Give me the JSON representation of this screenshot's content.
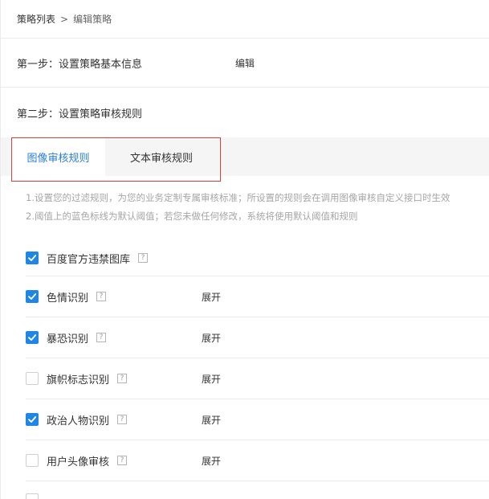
{
  "breadcrumb": {
    "list": "策略列表",
    "separator": ">",
    "current": "编辑策略"
  },
  "step1": {
    "title": "第一步：设置策略基本信息",
    "edit": "编辑"
  },
  "step2": {
    "title": "第二步：设置策略审核规则"
  },
  "tabs": [
    {
      "label": "图像审核规则",
      "active": true
    },
    {
      "label": "文本审核规则",
      "active": false
    }
  ],
  "notes": [
    "1.设置您的过滤规则，为您的业务定制专属审核标准；所设置的规则会在调用图像审核自定义接口时生效",
    "2.阈值上的蓝色标线为默认阈值；若您未做任何修改，系统将使用默认阈值和规则"
  ],
  "rules": [
    {
      "label": "百度官方违禁图库",
      "checked": true,
      "help": "?",
      "expand": ""
    },
    {
      "label": "色情识别",
      "checked": true,
      "help": "?",
      "expand": "展开"
    },
    {
      "label": "暴恐识别",
      "checked": true,
      "help": "?",
      "expand": "展开"
    },
    {
      "label": "旗帜标志识别",
      "checked": false,
      "help": "?",
      "expand": "展开"
    },
    {
      "label": "政治人物识别",
      "checked": true,
      "help": "?",
      "expand": "展开"
    },
    {
      "label": "用户头像审核",
      "checked": false,
      "help": "?",
      "expand": "展开"
    }
  ],
  "colors": {
    "accent": "#1f86e6",
    "active_tab_text": "#2a7ed8",
    "highlight": "#e03c3c"
  }
}
